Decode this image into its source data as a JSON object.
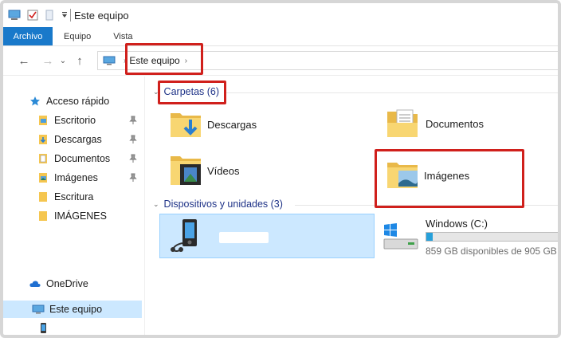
{
  "window": {
    "title": "Este equipo"
  },
  "ribbon": {
    "tabs": [
      "Archivo",
      "Equipo",
      "Vista"
    ]
  },
  "address": {
    "path": "Este equipo"
  },
  "sidebar": {
    "quick_access": "Acceso rápido",
    "items": [
      {
        "label": "Escritorio",
        "icon": "desktop-folder-icon",
        "pinned": true
      },
      {
        "label": "Descargas",
        "icon": "downloads-folder-icon",
        "pinned": true
      },
      {
        "label": "Documentos",
        "icon": "documents-folder-icon",
        "pinned": true
      },
      {
        "label": "Imágenes",
        "icon": "pictures-folder-icon",
        "pinned": true
      },
      {
        "label": "Escritura",
        "icon": "folder-icon",
        "pinned": false
      },
      {
        "label": "IMÁGENES",
        "icon": "folder-icon",
        "pinned": false
      }
    ],
    "onedrive": "OneDrive",
    "this_pc": "Este equipo"
  },
  "folders": {
    "header": "Carpetas (6)",
    "items": [
      {
        "label": "Descargas",
        "icon": "downloads-folder-icon"
      },
      {
        "label": "Documentos",
        "icon": "documents-folder-icon"
      },
      {
        "label": "Vídeos",
        "icon": "videos-folder-icon"
      },
      {
        "label": "Imágenes",
        "icon": "pictures-folder-icon"
      }
    ]
  },
  "devices": {
    "header": "Dispositivos y unidades (3)",
    "drive": {
      "name": "Windows (C:)",
      "free": "859 GB disponibles de 905 GB",
      "used_fraction": 0.05
    }
  },
  "colors": {
    "accent": "#1979ca",
    "highlight": "#d0201c",
    "selection": "#cce8ff",
    "folder": "#f5c650",
    "drive_bar": "#26a0da"
  }
}
